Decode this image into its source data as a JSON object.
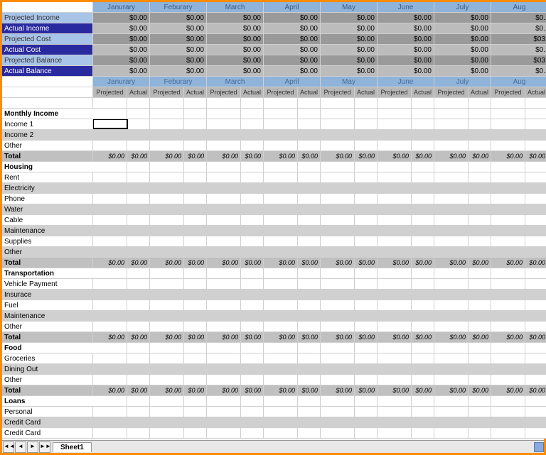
{
  "months": [
    "Janurary",
    "Feburary",
    "March",
    "April",
    "May",
    "June",
    "July",
    "Aug"
  ],
  "summary_rows": [
    {
      "label": "Projected Income",
      "style": "label-light",
      "valStyle": "value-dark",
      "vals": [
        "$0.00",
        "$0.00",
        "$0.00",
        "$0.00",
        "$0.00",
        "$0.00",
        "$0.00",
        "$0."
      ]
    },
    {
      "label": "Actual Income",
      "style": "label-dark",
      "valStyle": "value-light",
      "vals": [
        "$0.00",
        "$0.00",
        "$0.00",
        "$0.00",
        "$0.00",
        "$0.00",
        "$0.00",
        "$0."
      ]
    },
    {
      "label": "Projected Cost",
      "style": "label-light",
      "valStyle": "value-dark",
      "vals": [
        "$0.00",
        "$0.00",
        "$0.00",
        "$0.00",
        "$0.00",
        "$0.00",
        "$0.00",
        "$03"
      ]
    },
    {
      "label": "Actual Cost",
      "style": "label-dark",
      "valStyle": "value-light",
      "vals": [
        "$0.00",
        "$0.00",
        "$0.00",
        "$0.00",
        "$0.00",
        "$0.00",
        "$0.00",
        "$0."
      ]
    },
    {
      "label": "Projected Balance",
      "style": "label-light",
      "valStyle": "value-dark",
      "vals": [
        "$0.00",
        "$0.00",
        "$0.00",
        "$0.00",
        "$0.00",
        "$0.00",
        "$0.00",
        "$03"
      ]
    },
    {
      "label": "Actual Balance",
      "style": "label-dark",
      "valStyle": "value-light",
      "vals": [
        "$0.00",
        "$0.00",
        "$0.00",
        "$0.00",
        "$0.00",
        "$0.00",
        "$0.00",
        "$0."
      ]
    }
  ],
  "sub_headers": {
    "projected": "Projected",
    "actual": "Actual"
  },
  "sections": [
    {
      "name": "Monthly Income",
      "rows": [
        "Income 1",
        "Income 2",
        "Other"
      ],
      "has_total": true,
      "selected_row": 0
    },
    {
      "name": "Housing",
      "rows": [
        "Rent",
        "Electricity",
        "Phone",
        "Water",
        "Cable",
        "Maintenance",
        "Supplies",
        "Other"
      ],
      "has_total": true
    },
    {
      "name": "Transportation",
      "rows": [
        "Vehicle Payment",
        "Insurace",
        "Fuel",
        "Maintenance",
        "Other"
      ],
      "has_total": true
    },
    {
      "name": "Food",
      "rows": [
        "Groceries",
        "Dining Out",
        "Other"
      ],
      "has_total": true
    },
    {
      "name": "Loans",
      "rows": [
        "Personal",
        "Credit Card",
        "Credit Card"
      ],
      "has_total": false
    }
  ],
  "total_label": "Total",
  "total_value": "$0.00",
  "sheet_tab": "Sheet1",
  "nav": {
    "first": "◄◄",
    "prev": "◄",
    "next": "►",
    "last": "►►"
  }
}
